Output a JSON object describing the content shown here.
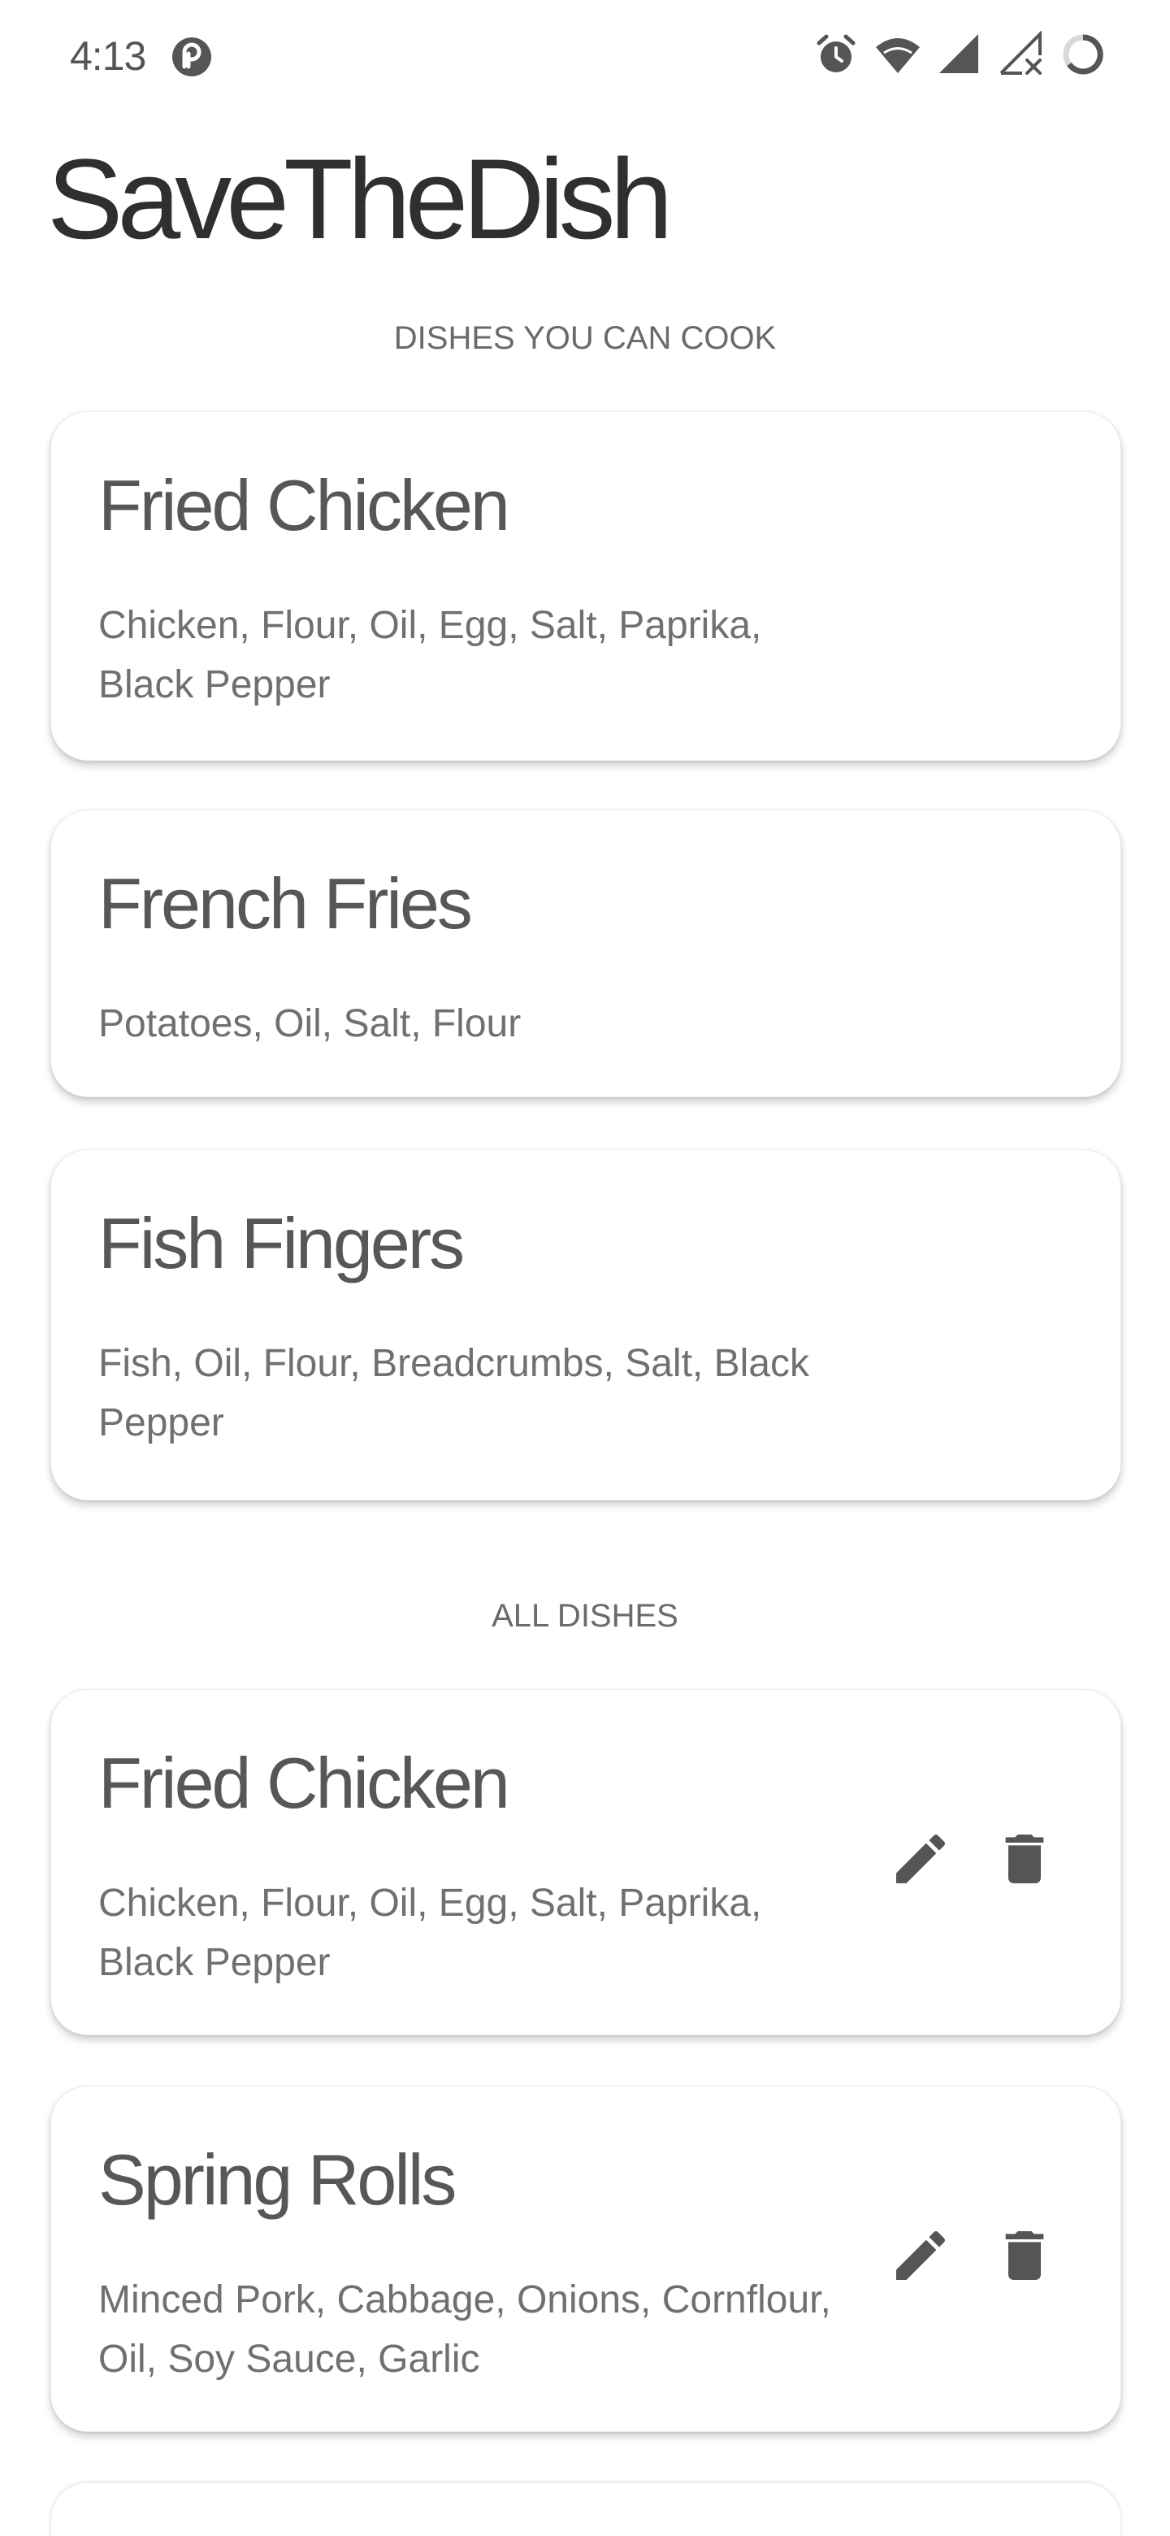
{
  "status_bar": {
    "time": "4:13",
    "app_icon": "pocketcasts-icon",
    "icons": [
      "alarm-icon",
      "wifi-icon",
      "signal-icon",
      "no-signal-icon",
      "battery-ring-icon"
    ]
  },
  "app": {
    "title": "SaveTheDish"
  },
  "sections": {
    "can_cook_header": "DISHES YOU CAN COOK",
    "all_dishes_header": "ALL DISHES"
  },
  "can_cook": [
    {
      "name": "Fried Chicken",
      "ingredients": "Chicken, Flour, Oil, Egg, Salt, Paprika, Black Pepper"
    },
    {
      "name": "French Fries",
      "ingredients": "Potatoes, Oil, Salt, Flour"
    },
    {
      "name": "Fish Fingers",
      "ingredients": "Fish, Oil, Flour, Breadcrumbs, Salt, Black Pepper"
    }
  ],
  "all_dishes": [
    {
      "name": "Fried Chicken",
      "ingredients": "Chicken, Flour, Oil, Egg, Salt, Paprika, Black Pepper",
      "actions": [
        "edit-icon",
        "delete-icon"
      ]
    },
    {
      "name": "Spring Rolls",
      "ingredients": "Minced Pork, Cabbage, Onions, Cornflour, Oil, Soy Sauce, Garlic",
      "actions": [
        "edit-icon",
        "delete-icon"
      ]
    }
  ],
  "colors": {
    "background": "#ffffff",
    "title_text": "#2f2f2f",
    "card_title": "#575757",
    "card_text": "#707070",
    "icon": "#555555"
  }
}
